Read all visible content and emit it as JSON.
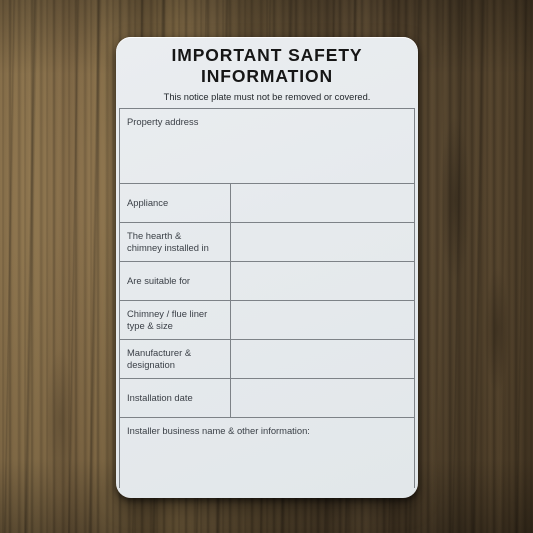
{
  "plate": {
    "title_line_1": "IMPORTANT SAFETY",
    "title_line_2": "INFORMATION",
    "subtitle": "This notice plate must not be removed or covered.",
    "fields": [
      {
        "label": "Property address",
        "value": "",
        "layout": "full-block"
      },
      {
        "label": "Appliance",
        "value": "",
        "layout": "two-column"
      },
      {
        "label": "The hearth &\nchimney installed in",
        "value": "",
        "layout": "two-column"
      },
      {
        "label": "Are suitable for",
        "value": "",
        "layout": "two-column"
      },
      {
        "label": "Chimney / flue liner\ntype & size",
        "value": "",
        "layout": "two-column"
      },
      {
        "label": "Manufacturer &\ndesignation",
        "value": "",
        "layout": "two-column"
      },
      {
        "label": "Installation date",
        "value": "",
        "layout": "two-column"
      },
      {
        "label": "Installer business name & other information:",
        "value": "",
        "layout": "full-block"
      }
    ],
    "colors": {
      "plate_surface": "#e6eaed",
      "border": "#7d8287",
      "title_text": "#161616",
      "label_text": "#3b4047"
    }
  },
  "background": {
    "material": "wood-panel",
    "grain_direction": "vertical",
    "colors": {
      "light_wood": "#8d7350",
      "dark_wood": "#4a3a24"
    }
  }
}
